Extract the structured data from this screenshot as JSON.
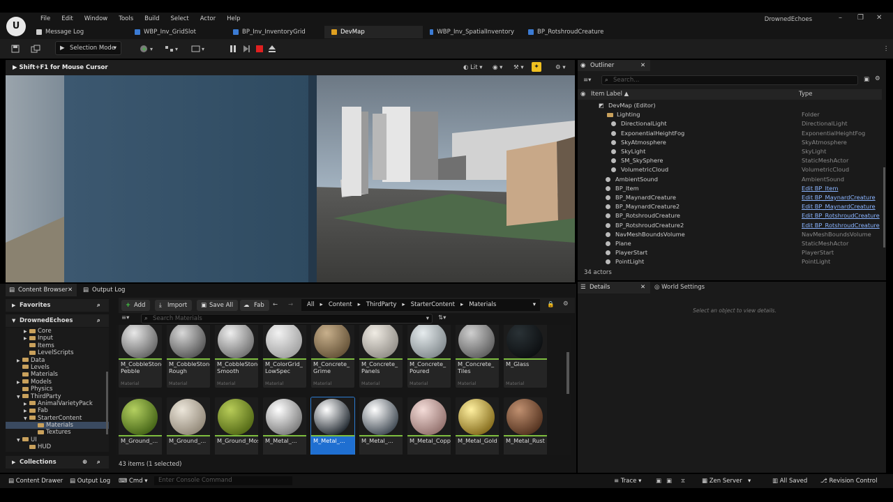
{
  "menu": [
    "File",
    "Edit",
    "Window",
    "Tools",
    "Build",
    "Select",
    "Actor",
    "Help"
  ],
  "project_name": "DrownedEchoes",
  "window_controls": {
    "minimize": "–",
    "maximize": "❐",
    "close": "✕"
  },
  "tabs": [
    {
      "label": "Message Log",
      "icon_color": "#cccccc"
    },
    {
      "label": "WBP_Inv_GridSlot",
      "icon_color": "#3b7bd4"
    },
    {
      "label": "BP_Inv_InventoryGrid",
      "icon_color": "#3b7bd4"
    },
    {
      "label": "DevMap",
      "icon_color": "#e0a020"
    },
    {
      "label": "WBP_Inv_SpatialInventory",
      "icon_color": "#3b7bd4"
    },
    {
      "label": "BP_RotshroudCreature",
      "icon_color": "#3b7bd4"
    }
  ],
  "toolbar": {
    "selection_mode": "Selection Mode"
  },
  "viewport": {
    "hint": "Shift+F1 for Mouse Cursor",
    "lit": "Lit"
  },
  "outliner": {
    "title": "Outliner",
    "search_placeholder": "Search...",
    "col_label": "Item Label ▲",
    "col_type": "Type",
    "rows": [
      {
        "label": "DevMap (Editor)",
        "type": "",
        "indent": 30,
        "icon": "map",
        "link": false
      },
      {
        "label": "Lighting",
        "type": "Folder",
        "indent": 42,
        "icon": "folder",
        "link": false
      },
      {
        "label": "DirectionalLight",
        "type": "DirectionalLight",
        "indent": 48,
        "icon": "dot",
        "link": false
      },
      {
        "label": "ExponentialHeightFog",
        "type": "ExponentialHeightFog",
        "indent": 48,
        "icon": "dot",
        "link": false
      },
      {
        "label": "SkyAtmosphere",
        "type": "SkyAtmosphere",
        "indent": 48,
        "icon": "dot",
        "link": false
      },
      {
        "label": "SkyLight",
        "type": "SkyLight",
        "indent": 48,
        "icon": "dot",
        "link": false
      },
      {
        "label": "SM_SkySphere",
        "type": "StaticMeshActor",
        "indent": 48,
        "icon": "dot",
        "link": false
      },
      {
        "label": "VolumetricCloud",
        "type": "VolumetricCloud",
        "indent": 48,
        "icon": "dot",
        "link": false
      },
      {
        "label": "AmbientSound",
        "type": "AmbientSound",
        "indent": 40,
        "icon": "dot",
        "link": false
      },
      {
        "label": "BP_Item",
        "type": "Edit BP_Item",
        "indent": 40,
        "icon": "dot",
        "link": true
      },
      {
        "label": "BP_MaynardCreature",
        "type": "Edit BP_MaynardCreature",
        "indent": 40,
        "icon": "dot",
        "link": true
      },
      {
        "label": "BP_MaynardCreature2",
        "type": "Edit BP_MaynardCreature",
        "indent": 40,
        "icon": "dot",
        "link": true
      },
      {
        "label": "BP_RotshroudCreature",
        "type": "Edit BP_RotshroudCreature",
        "indent": 40,
        "icon": "dot",
        "link": true
      },
      {
        "label": "BP_RotshroudCreature2",
        "type": "Edit BP_RotshroudCreature",
        "indent": 40,
        "icon": "dot",
        "link": true
      },
      {
        "label": "NavMeshBoundsVolume",
        "type": "NavMeshBoundsVolume",
        "indent": 40,
        "icon": "dot",
        "link": false
      },
      {
        "label": "Plane",
        "type": "StaticMeshActor",
        "indent": 40,
        "icon": "dot",
        "link": false
      },
      {
        "label": "PlayerStart",
        "type": "PlayerStart",
        "indent": 40,
        "icon": "dot",
        "link": false
      },
      {
        "label": "PointLight",
        "type": "PointLight",
        "indent": 40,
        "icon": "dot",
        "link": false
      }
    ],
    "count": "34 actors"
  },
  "details": {
    "title": "Details",
    "world_settings": "World Settings",
    "empty_msg": "Select an object to view details."
  },
  "content_browser": {
    "tab": "Content Browser",
    "output_log": "Output Log",
    "add": "Add",
    "import": "Import",
    "save_all": "Save All",
    "fab": "Fab",
    "breadcrumb": [
      "All",
      "Content",
      "ThirdParty",
      "StarterContent",
      "Materials"
    ],
    "search_placeholder": "Search Materials",
    "favorites": "Favorites",
    "project_root": "DrownedEchoes",
    "collections": "Collections",
    "status": "43 items (1 selected)",
    "tree": [
      {
        "label": "Core",
        "indent": 26,
        "arrow": true,
        "selected": false
      },
      {
        "label": "Input",
        "indent": 26,
        "arrow": true,
        "selected": false
      },
      {
        "label": "Items",
        "indent": 26,
        "arrow": false,
        "selected": false
      },
      {
        "label": "LevelScripts",
        "indent": 26,
        "arrow": false,
        "selected": false
      },
      {
        "label": "Data",
        "indent": 16,
        "arrow": true,
        "selected": false
      },
      {
        "label": "Levels",
        "indent": 16,
        "arrow": false,
        "selected": false
      },
      {
        "label": "Materials",
        "indent": 16,
        "arrow": false,
        "selected": false
      },
      {
        "label": "Models",
        "indent": 16,
        "arrow": true,
        "selected": false
      },
      {
        "label": "Physics",
        "indent": 16,
        "arrow": false,
        "selected": false
      },
      {
        "label": "ThirdParty",
        "indent": 16,
        "arrow": true,
        "selected": false,
        "open": true
      },
      {
        "label": "AnimalVarietyPack",
        "indent": 26,
        "arrow": true,
        "selected": false
      },
      {
        "label": "Fab",
        "indent": 26,
        "arrow": true,
        "selected": false
      },
      {
        "label": "StarterContent",
        "indent": 26,
        "arrow": true,
        "selected": false,
        "open": true
      },
      {
        "label": "Materials",
        "indent": 38,
        "arrow": false,
        "selected": true
      },
      {
        "label": "Textures",
        "indent": 38,
        "arrow": false,
        "selected": false
      },
      {
        "label": "UI",
        "indent": 16,
        "arrow": true,
        "selected": false,
        "open": true
      },
      {
        "label": "HUD",
        "indent": 26,
        "arrow": false,
        "selected": false
      }
    ],
    "assets": [
      {
        "name": "M_CobbleStone_\nPebble",
        "type": "Material",
        "c1": "#e8e8e8",
        "c2": "#5a5a5a",
        "selected": false
      },
      {
        "name": "M_CobbleStone_\nRough",
        "type": "Material",
        "c1": "#d8d8d8",
        "c2": "#4a4a4a",
        "selected": false
      },
      {
        "name": "M_CobbleStone_\nSmooth",
        "type": "Material",
        "c1": "#eeeeee",
        "c2": "#666666",
        "selected": false
      },
      {
        "name": "M_ColorGrid_\nLowSpec",
        "type": "Material",
        "c1": "#f2f2f2",
        "c2": "#9a9a9a",
        "selected": false
      },
      {
        "name": "M_Concrete_\nGrime",
        "type": "Material",
        "c1": "#c8b08c",
        "c2": "#5c4a30",
        "selected": false
      },
      {
        "name": "M_Concrete_\nPanels",
        "type": "Material",
        "c1": "#f0ece4",
        "c2": "#8a8680",
        "selected": false
      },
      {
        "name": "M_Concrete_\nPoured",
        "type": "Material",
        "c1": "#e6ecee",
        "c2": "#7a8286",
        "selected": false
      },
      {
        "name": "M_Concrete_\nTiles",
        "type": "Material",
        "c1": "#cfcfcf",
        "c2": "#555555",
        "selected": false
      },
      {
        "name": "M_Glass",
        "type": "Material",
        "c1": "#2a3236",
        "c2": "#0a0c0e",
        "selected": false
      },
      {
        "name": "M_Ground_...",
        "type": "",
        "c1": "#b4d060",
        "c2": "#3a5a10",
        "selected": false
      },
      {
        "name": "M_Ground_...",
        "type": "",
        "c1": "#ece6da",
        "c2": "#8a8070",
        "selected": false
      },
      {
        "name": "M_Ground_Moss",
        "type": "",
        "c1": "#b8cc58",
        "c2": "#4a6010",
        "selected": false
      },
      {
        "name": "M_Metal_...",
        "type": "",
        "c1": "#ffffff",
        "c2": "#707070",
        "selected": false
      },
      {
        "name": "M_Metal_...",
        "type": "",
        "c1": "#ffffff",
        "c2": "#101820",
        "selected": true
      },
      {
        "name": "M_Metal_...",
        "type": "",
        "c1": "#ffffff",
        "c2": "#303a44",
        "selected": false
      },
      {
        "name": "M_Metal_Copper",
        "type": "",
        "c1": "#f4dcd8",
        "c2": "#8a6864",
        "selected": false
      },
      {
        "name": "M_Metal_Gold",
        "type": "",
        "c1": "#fff0a0",
        "c2": "#7a6010",
        "selected": false
      },
      {
        "name": "M_Metal_Rust",
        "type": "",
        "c1": "#c09070",
        "c2": "#4a2a18",
        "selected": false
      }
    ]
  },
  "statusbar": {
    "content_drawer": "Content Drawer",
    "output_log": "Output Log",
    "cmd": "Cmd",
    "console_placeholder": "Enter Console Command",
    "trace": "Trace",
    "zen": "Zen Server",
    "all_saved": "All Saved",
    "revision": "Revision Control"
  }
}
